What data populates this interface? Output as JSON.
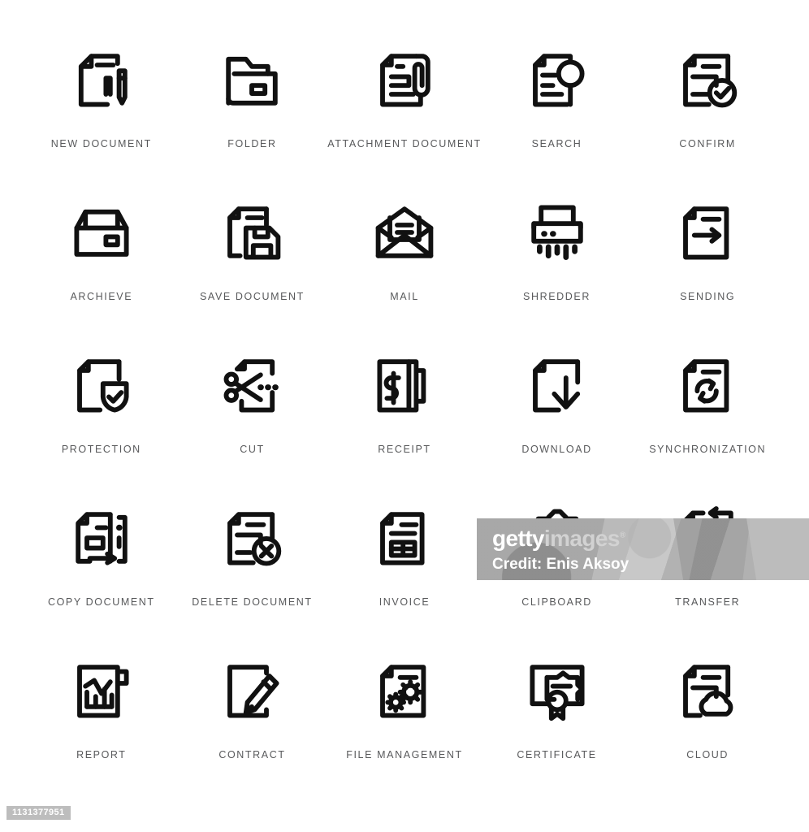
{
  "page": {
    "background_color": "#ffffff",
    "icon_stroke_color": "#111111",
    "label_color": "#58595b"
  },
  "grid": {
    "columns": 5,
    "rows": 5
  },
  "icons": [
    {
      "label": "NEW DOCUMENT",
      "icon_name": "new-document-icon"
    },
    {
      "label": "FOLDER",
      "icon_name": "folder-icon"
    },
    {
      "label": "ATTACHMENT DOCUMENT",
      "icon_name": "attachment-document-icon"
    },
    {
      "label": "SEARCH",
      "icon_name": "search-document-icon"
    },
    {
      "label": "CONFIRM",
      "icon_name": "confirm-document-icon"
    },
    {
      "label": "ARCHIEVE",
      "icon_name": "archive-box-icon"
    },
    {
      "label": "SAVE DOCUMENT",
      "icon_name": "save-document-icon"
    },
    {
      "label": "MAIL",
      "icon_name": "mail-envelope-icon"
    },
    {
      "label": "SHREDDER",
      "icon_name": "shredder-icon"
    },
    {
      "label": "SENDING",
      "icon_name": "sending-document-icon"
    },
    {
      "label": "PROTECTION",
      "icon_name": "protection-shield-document-icon"
    },
    {
      "label": "CUT",
      "icon_name": "cut-scissors-document-icon"
    },
    {
      "label": "RECEIPT",
      "icon_name": "receipt-dollar-icon"
    },
    {
      "label": "DOWNLOAD",
      "icon_name": "download-document-icon"
    },
    {
      "label": "SYNCHRONIZATION",
      "icon_name": "synchronization-document-icon"
    },
    {
      "label": "COPY DOCUMENT",
      "icon_name": "copy-document-icon"
    },
    {
      "label": "DELETE DOCUMENT",
      "icon_name": "delete-document-icon"
    },
    {
      "label": "INVOICE",
      "icon_name": "invoice-document-icon"
    },
    {
      "label": "CLIPBOARD",
      "icon_name": "clipboard-icon"
    },
    {
      "label": "TRANSFER",
      "icon_name": "transfer-document-icon"
    },
    {
      "label": "REPORT",
      "icon_name": "report-chart-document-icon"
    },
    {
      "label": "CONTRACT",
      "icon_name": "contract-pen-document-icon"
    },
    {
      "label": "FILE MANAGEMENT",
      "icon_name": "file-management-gears-icon"
    },
    {
      "label": "CERTIFICATE",
      "icon_name": "certificate-seal-icon"
    },
    {
      "label": "CLOUD",
      "icon_name": "cloud-document-icon"
    }
  ],
  "watermark": {
    "brand_getty": "getty",
    "brand_images": "images",
    "registered_mark": "®",
    "credit": "Credit: Enis Aksoy"
  },
  "asset_id": "1131377951"
}
